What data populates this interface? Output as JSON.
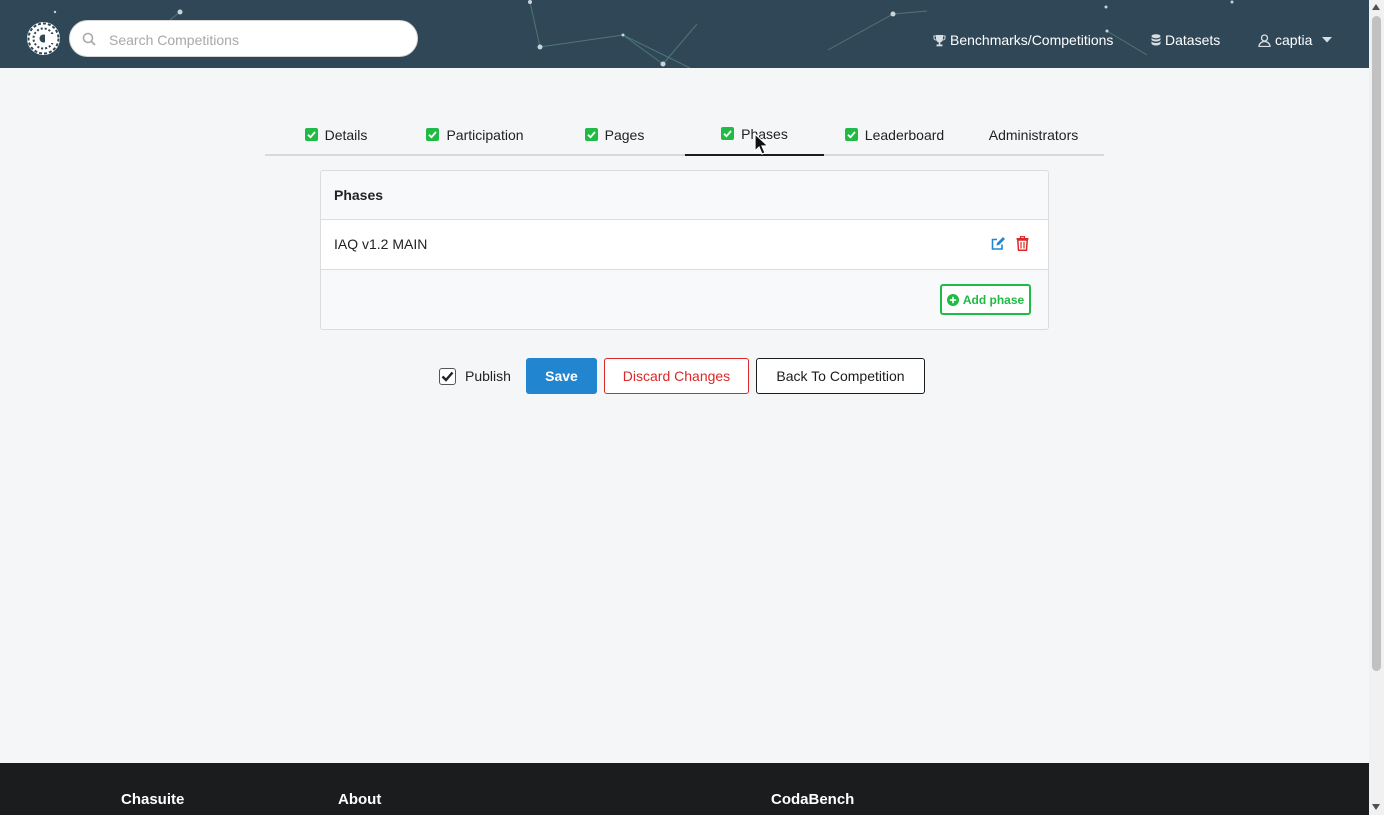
{
  "header": {
    "search_placeholder": "Search Competitions",
    "nav": {
      "benchmarks": "Benchmarks/Competitions",
      "datasets": "Datasets",
      "user": "captia"
    }
  },
  "tabs": [
    {
      "label": "Details",
      "checked": true
    },
    {
      "label": "Participation",
      "checked": true
    },
    {
      "label": "Pages",
      "checked": true
    },
    {
      "label": "Phases",
      "checked": true,
      "active": true
    },
    {
      "label": "Leaderboard",
      "checked": true
    },
    {
      "label": "Administrators",
      "checked": false
    }
  ],
  "phases_card": {
    "title": "Phases",
    "phases": [
      {
        "name": "IAQ v1.2 MAIN"
      }
    ],
    "add_phase_label": "Add phase"
  },
  "actions": {
    "publish_label": "Publish",
    "publish_checked": true,
    "save_label": "Save",
    "discard_label": "Discard Changes",
    "back_label": "Back To Competition"
  },
  "footer": {
    "col1": "Chasuite",
    "col2": "About",
    "col3": "CodaBench"
  },
  "colors": {
    "navbar": "#2f4756",
    "check_green": "#21ba45",
    "save_blue": "#2185d0",
    "discard_red": "#db2828",
    "footer": "#1b1c1d"
  },
  "icons": {
    "search": "search-icon",
    "trophy": "trophy-icon",
    "database": "database-icon",
    "user": "user-icon",
    "dropdown": "caret-down-icon",
    "check": "check-square-icon",
    "edit": "edit-icon",
    "delete": "trash-icon",
    "add": "plus-circle-icon"
  }
}
